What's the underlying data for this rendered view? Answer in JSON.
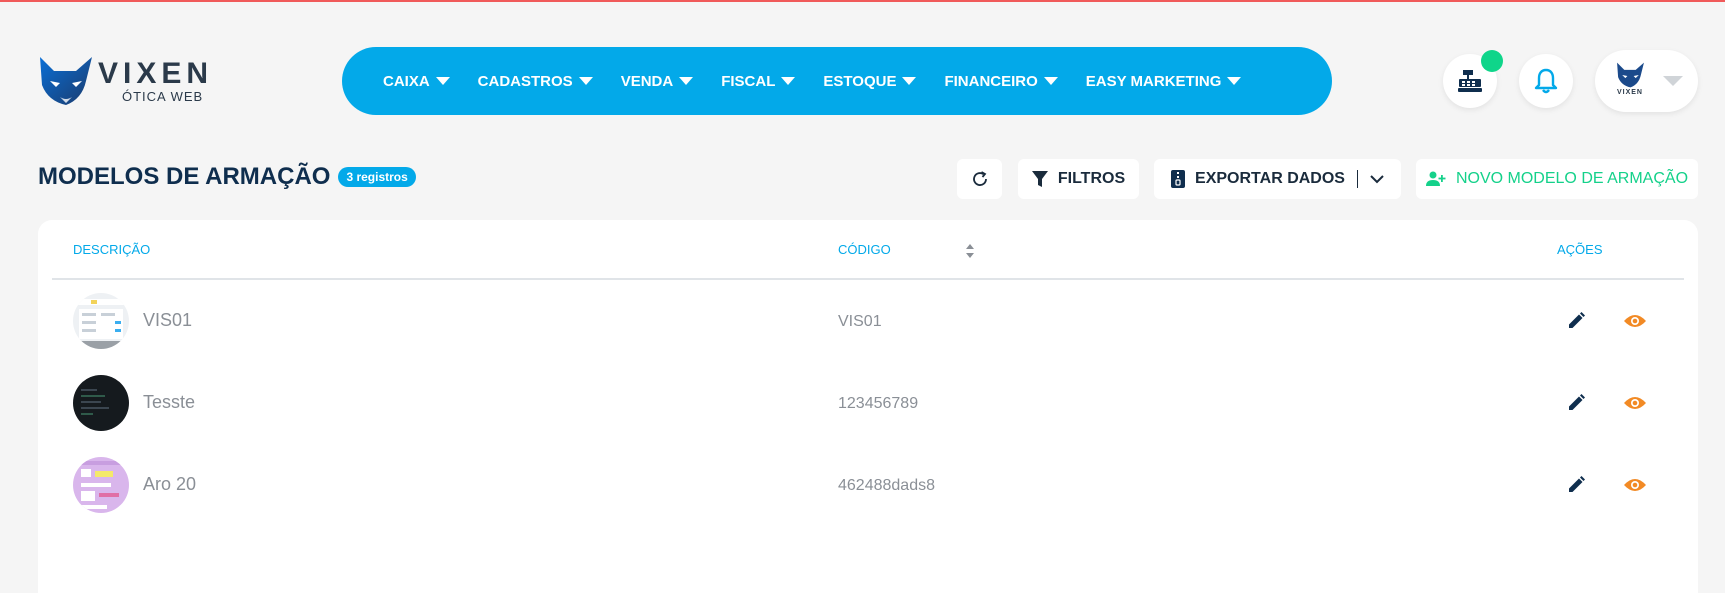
{
  "brand": {
    "name": "VIXEN",
    "subtitle": "ÓTICA WEB",
    "color": "#2b3a4a"
  },
  "nav": {
    "items": [
      {
        "label": "CAIXA"
      },
      {
        "label": "CADASTROS"
      },
      {
        "label": "VENDA"
      },
      {
        "label": "FISCAL"
      },
      {
        "label": "ESTOQUE"
      },
      {
        "label": "FINANCEIRO"
      },
      {
        "label": "EASY MARKETING"
      }
    ],
    "background": "#03a9e9"
  },
  "header_icons": [
    "cash-register-icon",
    "bell-icon"
  ],
  "profile": {
    "logo_text": "VIXEN"
  },
  "page": {
    "title": "MODELOS DE ARMAÇÃO",
    "count_badge": "3 registros"
  },
  "toolbar": {
    "refresh_icon": "refresh-icon",
    "filters_label": "FILTROS",
    "export_label": "EXPORTAR DADOS",
    "new_label": "NOVO MODELO DE ARMAÇÃO",
    "new_color": "#14d18a"
  },
  "table": {
    "columns": {
      "description": "DESCRIÇÃO",
      "code": "CÓDIGO",
      "actions": "AÇÕES"
    },
    "rows": [
      {
        "description": "VIS01",
        "code": "VIS01",
        "thumb_style": "light"
      },
      {
        "description": "Tesste",
        "code": "123456789",
        "thumb_style": "dark"
      },
      {
        "description": "Aro 20",
        "code": "462488dads8",
        "thumb_style": "purple"
      }
    ],
    "edit_icon": "pencil-icon",
    "view_icon": "eye-icon",
    "view_color": "#f28a25"
  }
}
